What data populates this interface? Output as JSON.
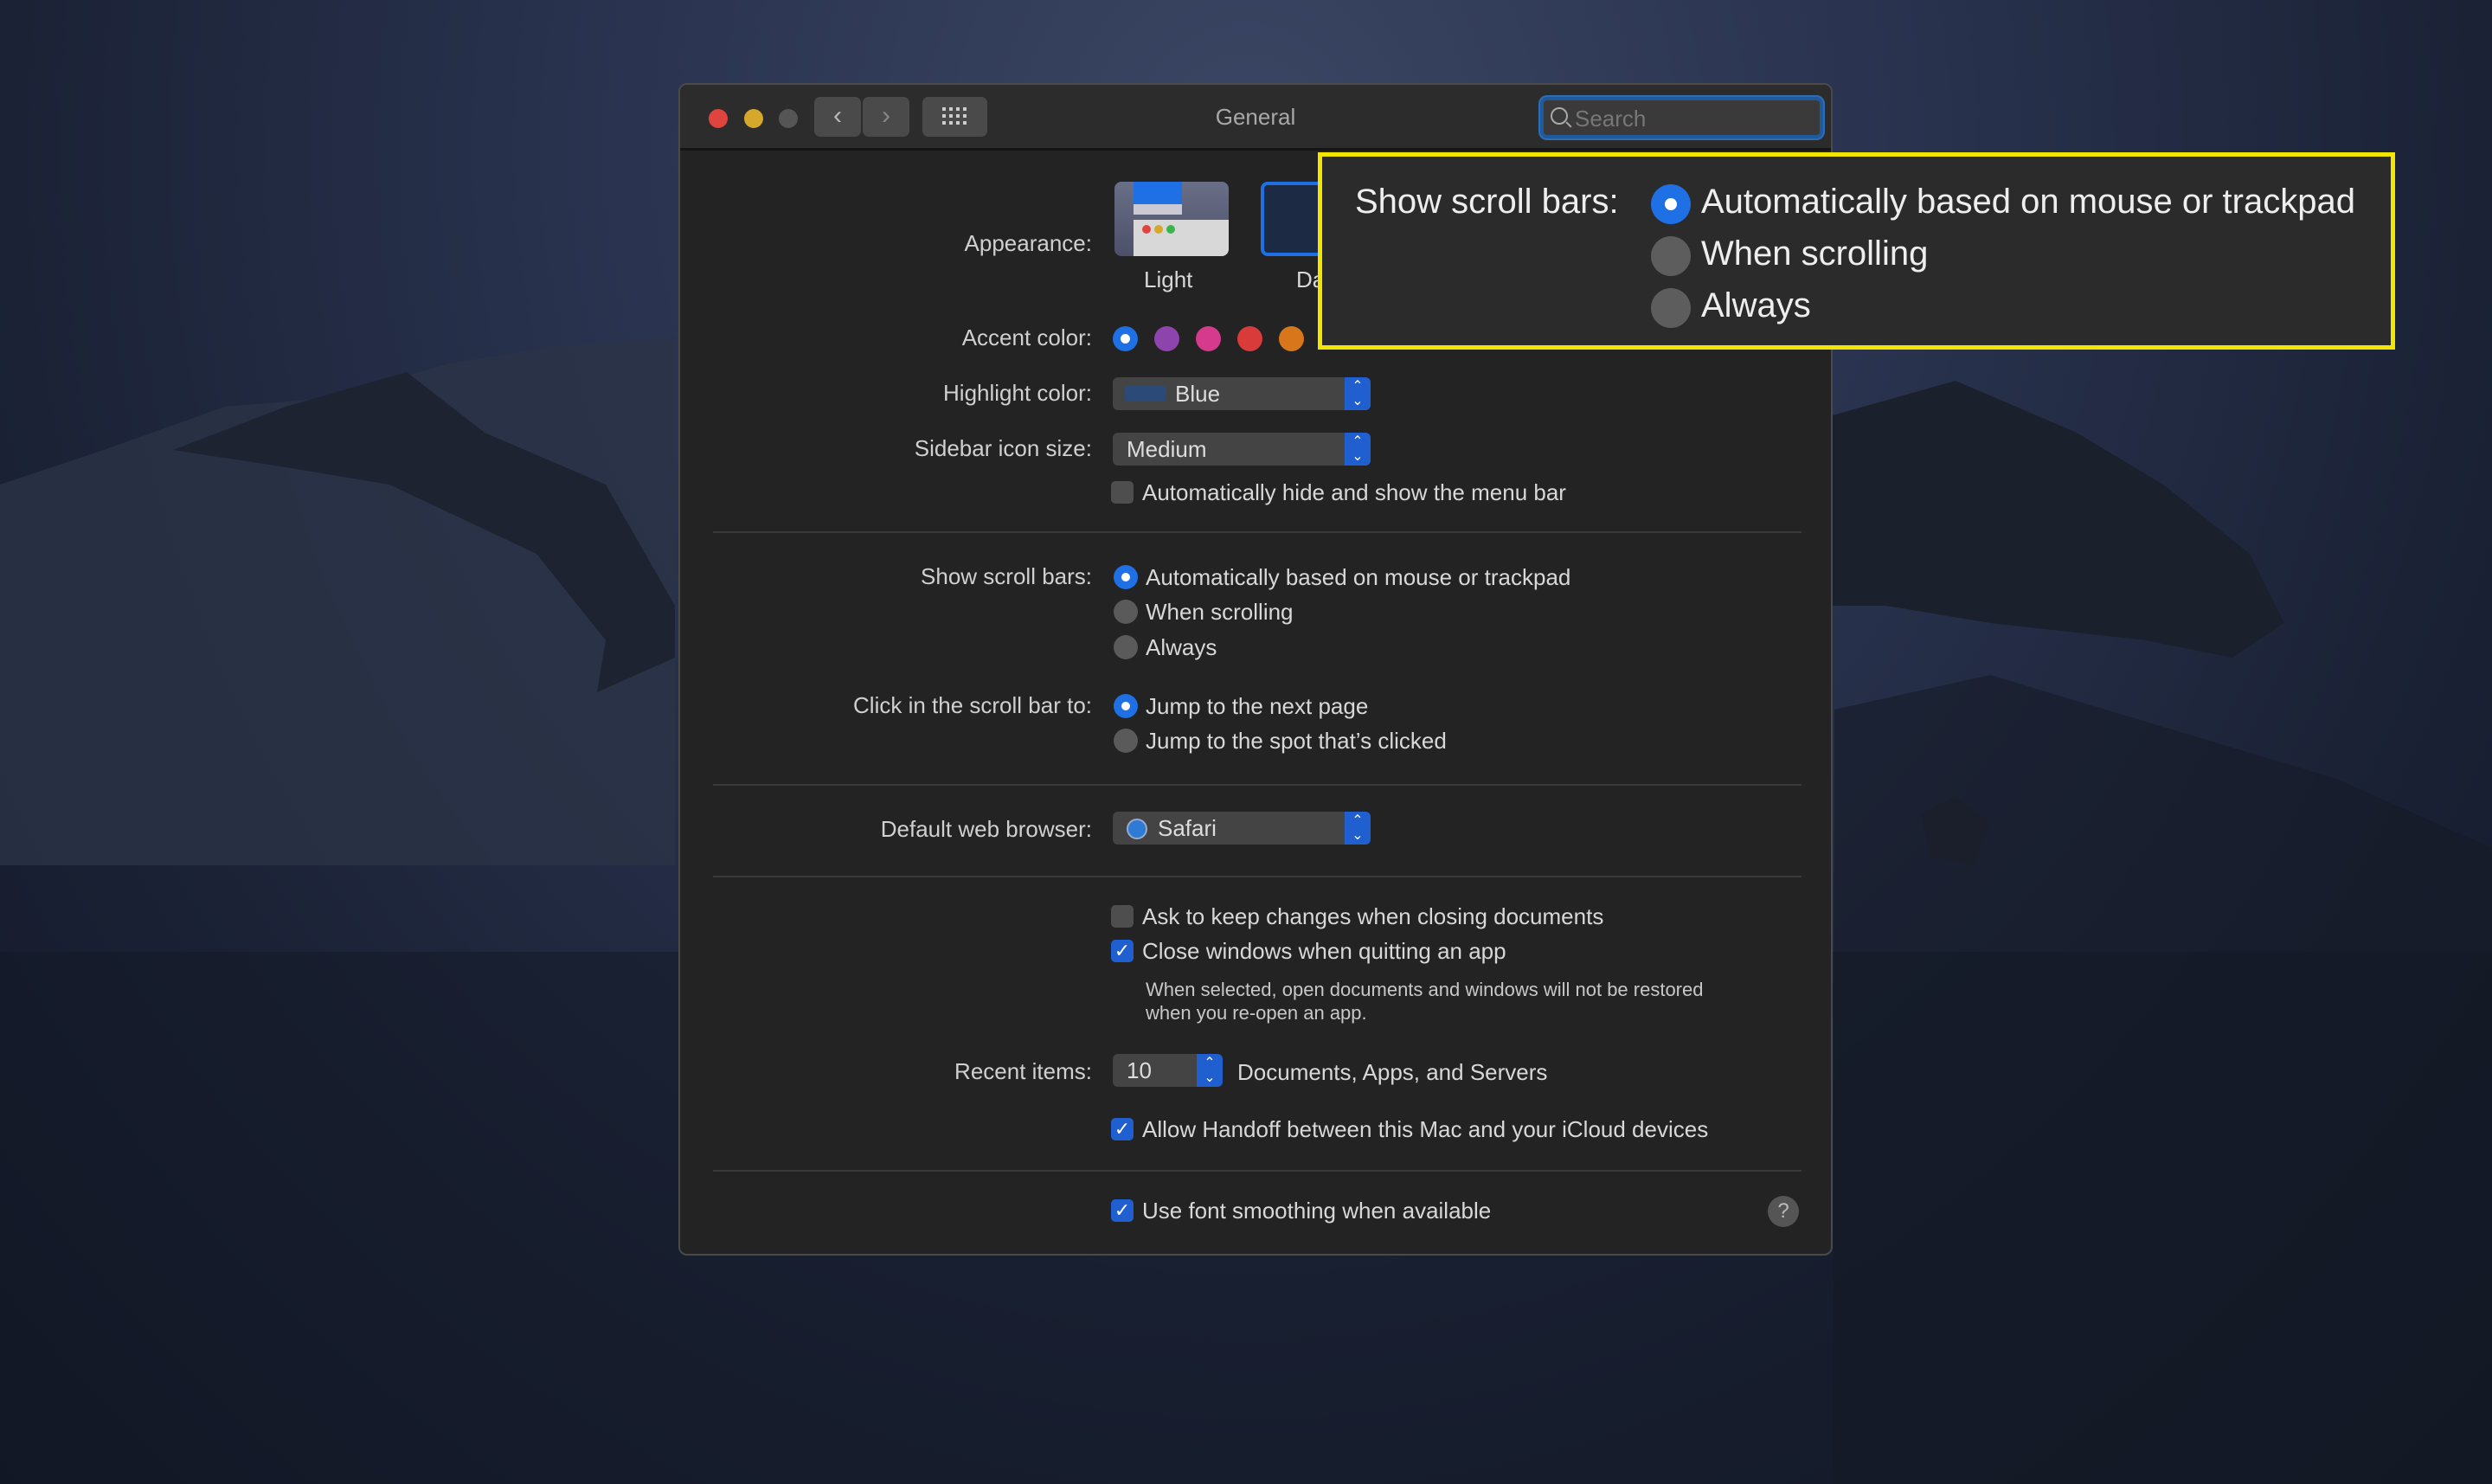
{
  "window": {
    "title": "General",
    "search_placeholder": "Search"
  },
  "appearance": {
    "label": "Appearance:",
    "options": [
      {
        "label": "Light"
      },
      {
        "label": "Dark",
        "visible_text": "Da"
      }
    ],
    "selected": "Dark"
  },
  "accent_color": {
    "label": "Accent color:",
    "colors": [
      "#1f6fe5",
      "#8e44ad",
      "#d63a8c",
      "#d93a3a",
      "#d8761c"
    ],
    "selected": 0
  },
  "highlight_color": {
    "label": "Highlight color:",
    "value": "Blue",
    "swatch": "#2c4a78"
  },
  "sidebar_icon_size": {
    "label": "Sidebar icon size:",
    "value": "Medium"
  },
  "auto_hide_menu": {
    "label": "Automatically hide and show the menu bar",
    "checked": false
  },
  "scroll_bars": {
    "label": "Show scroll bars:",
    "options": [
      "Automatically based on mouse or trackpad",
      "When scrolling",
      "Always"
    ],
    "selected": 0
  },
  "click_scroll": {
    "label": "Click in the scroll bar to:",
    "options": [
      "Jump to the next page",
      "Jump to the spot that’s clicked"
    ],
    "selected": 0
  },
  "browser": {
    "label": "Default web browser:",
    "value": "Safari"
  },
  "ask_keep": {
    "label": "Ask to keep changes when closing documents",
    "checked": false
  },
  "close_windows": {
    "label": "Close windows when quitting an app",
    "checked": true,
    "note_1": "When selected, open documents and windows will not be restored",
    "note_2": "when you re-open an app."
  },
  "recent_items": {
    "label": "Recent items:",
    "value": "10",
    "suffix": "Documents, Apps, and Servers"
  },
  "handoff": {
    "label": "Allow Handoff between this Mac and your iCloud devices",
    "checked": true
  },
  "font_smoothing": {
    "label": "Use font smoothing when available",
    "checked": true
  },
  "help": {
    "label": "?"
  },
  "callout": {
    "label": "Show scroll bars:",
    "options": [
      "Automatically based on mouse or trackpad",
      "When scrolling",
      "Always"
    ],
    "selected": 0,
    "border_color": "#f2e500"
  },
  "icons": {
    "check": "✓",
    "back": "‹",
    "forward": "›",
    "stepper": "⌃⌄"
  }
}
